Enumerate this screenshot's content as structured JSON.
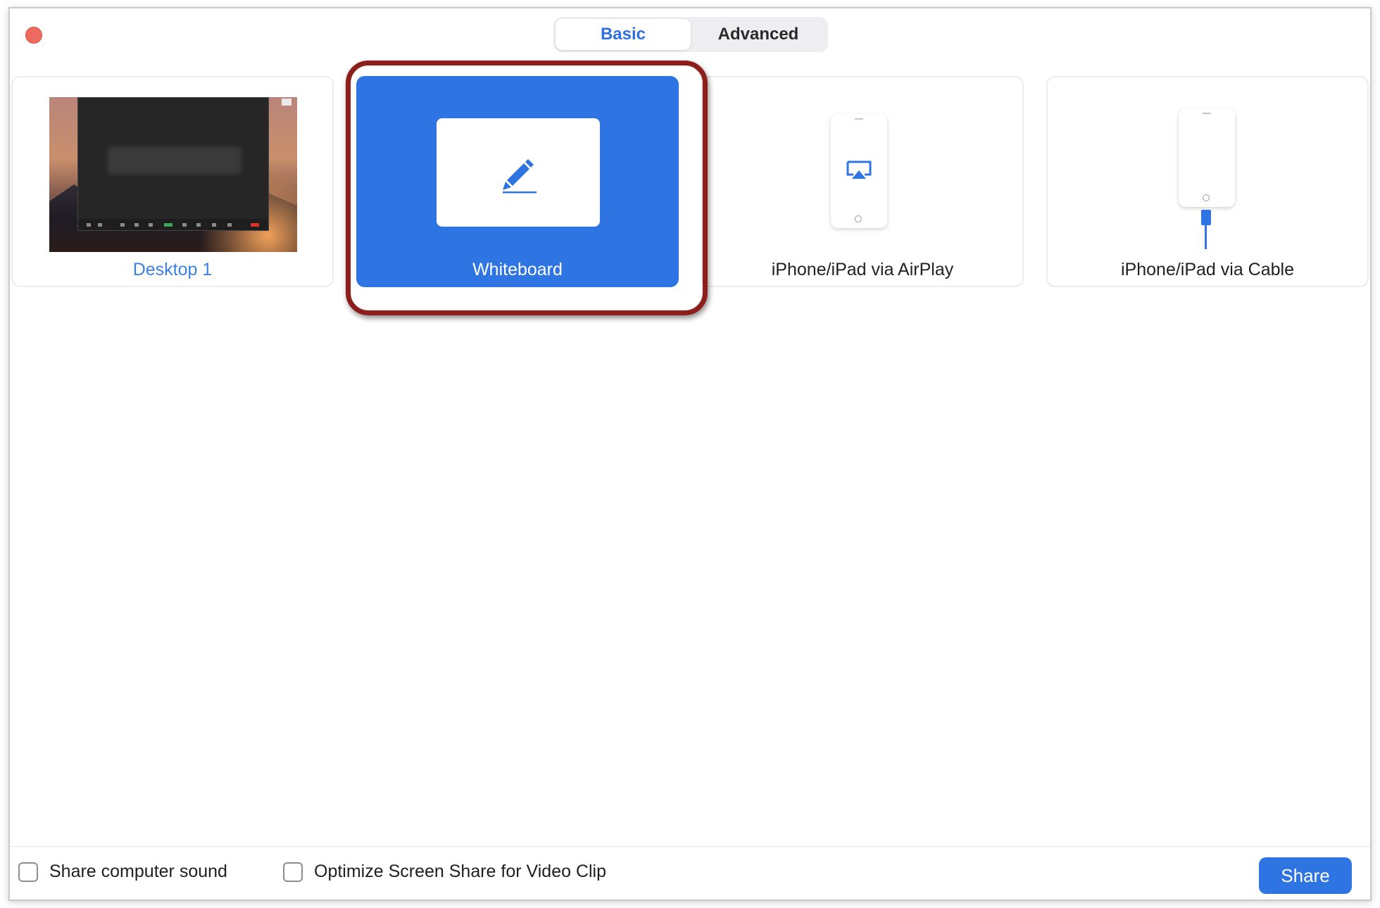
{
  "tabs": [
    {
      "label": "Basic",
      "active": true
    },
    {
      "label": "Advanced",
      "active": false
    }
  ],
  "options": {
    "desktop": {
      "label": "Desktop 1"
    },
    "whiteboard": {
      "label": "Whiteboard",
      "selected": true
    },
    "airplay": {
      "label": "iPhone/iPad via AirPlay"
    },
    "cable": {
      "label": "iPhone/iPad via Cable"
    }
  },
  "footer": {
    "share_sound_label": "Share computer sound",
    "optimize_label": "Optimize Screen Share for Video Clip",
    "share_button_label": "Share"
  },
  "colors": {
    "accent": "#2e74e3",
    "annotation": "#8c1e1c",
    "close": "#ec6a5e"
  },
  "icons": {
    "close": "close-dot-icon",
    "whiteboard": "pencil-icon",
    "airplay": "airplay-icon",
    "cable": "lightning-cable-icon"
  }
}
